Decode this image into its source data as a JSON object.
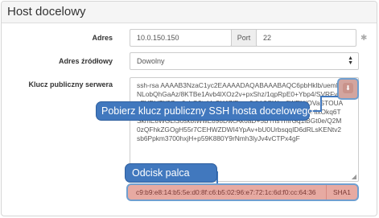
{
  "panel": {
    "title": "Host docelowy"
  },
  "form": {
    "address": {
      "label": "Adres",
      "value": "10.0.150.150"
    },
    "port": {
      "label": "Port",
      "value": "22"
    },
    "source_address": {
      "label": "Adres źródłowy",
      "value": "Dowolny"
    },
    "public_key": {
      "label": "Klucz publiczny serwera",
      "value": "ssh-rsa AAAAB3NzaC1yc2EAAAADAQABAAABAQC6pbHklb/uemFNLobQhGaAz/8KTBe1Avb4lXOz2v+pxShz/1qpRpE0+Ybp4/SVRFvtvnFVPLiTI/9Zxq0vbQ2tuVpSY4Z/Fza+0dVr0OWaz6WEH/OVaSTOUAX1j21wx8d8Rk3y0nMCzLD0q/Up8c2rTK2dMsxNf/FGMQ5HixOkq6TSkmE8WGLlSosk8tWwE898DwcAk6aD+5BThsTmrGq1lBGt0e/Q2M0zQFhkZGOgH55r7CEHWZDWI4YpAv+bU0UrbsqqID6dRLsKENtv2sb6Ppkm3700hxjH+p59K880Y9rNmh3lyJv4vCTPx4gF"
    },
    "fingerprint": {
      "value": "c9:b9:e8:14:b5:5e:d0:8f:c6:b5:02:96:e7:72:1c:6d:f0:cc:64:36",
      "algorithm": "SHA1"
    }
  },
  "callouts": {
    "fetch_key": "Pobierz klucz publiczny SSH hosta docelowego",
    "fingerprint": "Odcisk palca"
  },
  "icons": {
    "required": "asterisk-icon",
    "select": "select-arrows-icon",
    "fetch": "download-key-icon",
    "resize": "resize-grip-icon"
  }
}
